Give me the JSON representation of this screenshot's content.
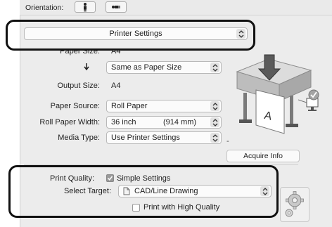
{
  "orientation": {
    "label": "Orientation:",
    "portrait_icon": "portrait-orientation-icon",
    "landscape_icon": "landscape-orientation-icon"
  },
  "panel_select": {
    "value": "Printer Settings",
    "icon": "updown-arrows-icon"
  },
  "settings": {
    "paper_size_label": "Paper Size:",
    "paper_size_value": "A4",
    "down_arrow_icon": "down-arrow-icon",
    "output_mode_value": "Same as Paper Size",
    "output_size_label": "Output Size:",
    "output_size_value": "A4",
    "paper_source_label": "Paper Source:",
    "paper_source_value": "Roll Paper",
    "roll_width_label": "Roll Paper Width:",
    "roll_width_value": "36 inch",
    "roll_width_mm": "(914 mm)",
    "media_type_label": "Media Type:",
    "media_type_value": "Use Printer Settings",
    "acquire_label": "Acquire Info"
  },
  "quality": {
    "print_quality_label": "Print Quality:",
    "simple_settings_label": "Simple Settings",
    "simple_settings_checked": true,
    "select_target_label": "Select Target:",
    "select_target_value": "CAD/Line Drawing",
    "high_quality_label": "Print with High Quality",
    "high_quality_checked": false
  },
  "colors": {
    "highlight": "#111111",
    "panel_bg": "#ececec"
  }
}
